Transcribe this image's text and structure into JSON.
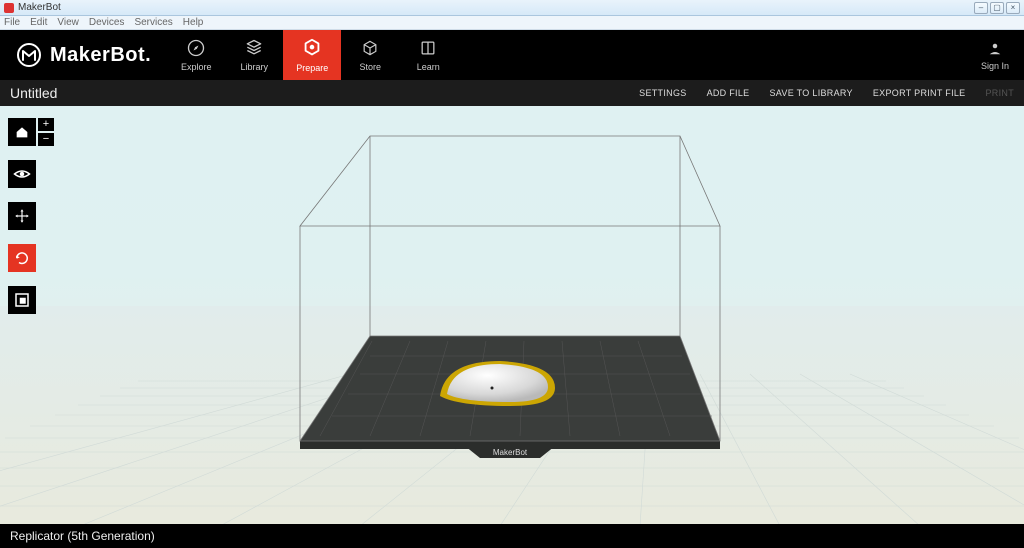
{
  "window": {
    "title": "MakerBot",
    "menus": [
      "File",
      "Edit",
      "View",
      "Devices",
      "Services",
      "Help"
    ]
  },
  "nav": {
    "brand": "MakerBot",
    "items": [
      {
        "id": "explore",
        "label": "Explore"
      },
      {
        "id": "library",
        "label": "Library"
      },
      {
        "id": "prepare",
        "label": "Prepare",
        "active": true
      },
      {
        "id": "store",
        "label": "Store"
      },
      {
        "id": "learn",
        "label": "Learn"
      }
    ],
    "signin": "Sign In"
  },
  "subbar": {
    "doc_title": "Untitled",
    "actions": {
      "settings": "SETTINGS",
      "add_file": "ADD FILE",
      "save_to_library": "SAVE TO LIBRARY",
      "export_print_file": "EXPORT PRINT FILE",
      "print": "PRINT"
    }
  },
  "tools": {
    "home": "home-view",
    "zoom_in": "+",
    "zoom_out": "−",
    "view": "view-toggle",
    "move": "move",
    "rotate": "rotate",
    "scale": "scale"
  },
  "bottom": {
    "printer": "Replicator (5th Generation)"
  },
  "scene": {
    "plate_label": "MakerBot"
  },
  "colors": {
    "accent": "#e53422",
    "nav_bg": "#000000",
    "subbar_bg": "#1c1c1c"
  }
}
